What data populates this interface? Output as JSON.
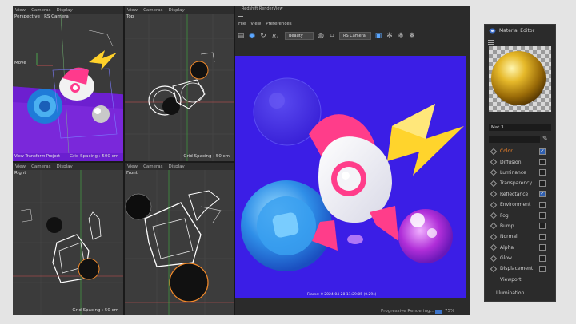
{
  "colors": {
    "render_bg": "#3b1ee6",
    "active_channel": "#ff8a2a",
    "checkbox_check": "#ffffff",
    "progress": "#3d74c9"
  },
  "viewports": [
    {
      "id": "perspective",
      "menu": [
        "View",
        "Cameras",
        "Display"
      ],
      "name": "Perspective",
      "camera": "RS Camera",
      "extra": "Move",
      "footer_left": "View Transform Project",
      "footer": "Grid Spacing : 500 cm"
    },
    {
      "id": "top",
      "menu": [
        "View",
        "Cameras",
        "Display"
      ],
      "name": "Top",
      "camera": "",
      "extra": "",
      "footer_left": "",
      "footer": "Grid Spacing : 50 cm"
    },
    {
      "id": "right",
      "menu": [
        "View",
        "Cameras",
        "Display"
      ],
      "name": "Right",
      "camera": "",
      "extra": "",
      "footer_left": "",
      "footer": "Grid Spacing : 50 cm"
    },
    {
      "id": "front",
      "menu": [
        "View",
        "Cameras",
        "Display"
      ],
      "name": "Front",
      "camera": "",
      "extra": "",
      "footer_left": "",
      "footer": "Grid Spacing : 50 cm"
    }
  ],
  "render_view": {
    "title": "Redshift RenderView",
    "menu": [
      "File",
      "View",
      "Preferences"
    ],
    "tools": {
      "rt": "RT",
      "beauty": "Beauty",
      "camera": "RS Camera"
    },
    "frame_info": "Frame: 0   2024-04-28  11:29:05  (0.29s)",
    "status": "Progressive Rendering...",
    "percent": "75%",
    "progress_fraction": 0.75
  },
  "material_editor": {
    "title": "Material Editor",
    "material_name": "Mat.3",
    "channels": [
      {
        "label": "Color",
        "checked": true,
        "active": true
      },
      {
        "label": "Diffusion",
        "checked": false
      },
      {
        "label": "Luminance",
        "checked": false
      },
      {
        "label": "Transparency",
        "checked": false
      },
      {
        "label": "Reflectance",
        "checked": true
      },
      {
        "label": "Environment",
        "checked": false
      },
      {
        "label": "Fog",
        "checked": false
      },
      {
        "label": "Bump",
        "checked": false
      },
      {
        "label": "Normal",
        "checked": false
      },
      {
        "label": "Alpha",
        "checked": false
      },
      {
        "label": "Glow",
        "checked": false
      },
      {
        "label": "Displacement",
        "checked": false
      }
    ],
    "extra_items": [
      "Viewport",
      "Illumination"
    ],
    "check_glyph": "✓"
  }
}
